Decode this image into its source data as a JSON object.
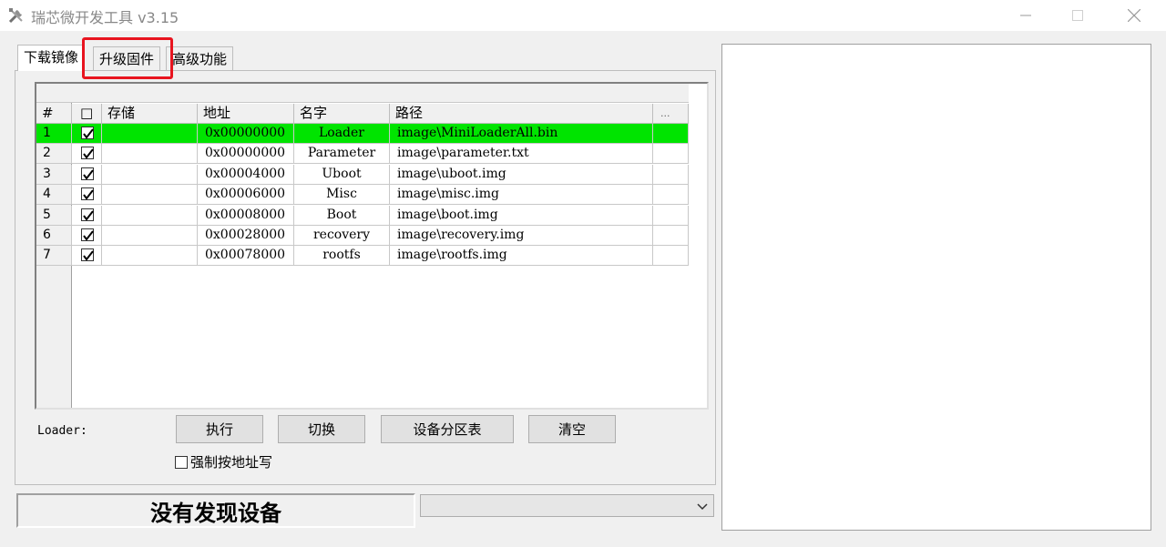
{
  "window": {
    "title": "瑞芯微开发工具 v3.15",
    "app_icon": "tools-icon",
    "controls": [
      "minimize-icon",
      "maximize-icon",
      "close-icon"
    ]
  },
  "tabs": [
    {
      "label": "下载镜像",
      "active": true
    },
    {
      "label": "升级固件",
      "active": false
    },
    {
      "label": "高级功能",
      "active": false
    }
  ],
  "highlight_color": "#e8141f",
  "table": {
    "headers": {
      "num": "#",
      "check": "□",
      "storage": "存储",
      "address": "地址",
      "name": "名字",
      "path": "路径",
      "more": "..."
    },
    "rows": [
      {
        "num": "1",
        "checked": true,
        "storage": "",
        "address": "0x00000000",
        "name": "Loader",
        "path": "image\\MiniLoaderAll.bin",
        "selected": true
      },
      {
        "num": "2",
        "checked": true,
        "storage": "",
        "address": "0x00000000",
        "name": "Parameter",
        "path": "image\\parameter.txt",
        "selected": false
      },
      {
        "num": "3",
        "checked": true,
        "storage": "",
        "address": "0x00004000",
        "name": "Uboot",
        "path": "image\\uboot.img",
        "selected": false
      },
      {
        "num": "4",
        "checked": true,
        "storage": "",
        "address": "0x00006000",
        "name": "Misc",
        "path": "image\\misc.img",
        "selected": false
      },
      {
        "num": "5",
        "checked": true,
        "storage": "",
        "address": "0x00008000",
        "name": "Boot",
        "path": "image\\boot.img",
        "selected": false
      },
      {
        "num": "6",
        "checked": true,
        "storage": "",
        "address": "0x00028000",
        "name": "recovery",
        "path": "image\\recovery.img",
        "selected": false
      },
      {
        "num": "7",
        "checked": true,
        "storage": "",
        "address": "0x00078000",
        "name": "rootfs",
        "path": "image\\rootfs.img",
        "selected": false
      }
    ],
    "selected_color": "#00e400"
  },
  "controls": {
    "loader_label": "Loader:",
    "execute": "执行",
    "switch": "切换",
    "partition_table": "设备分区表",
    "clear": "清空",
    "force_address_write": "强制按地址写",
    "force_address_checked": false
  },
  "status": {
    "text": "没有发现设备",
    "combo_value": ""
  }
}
